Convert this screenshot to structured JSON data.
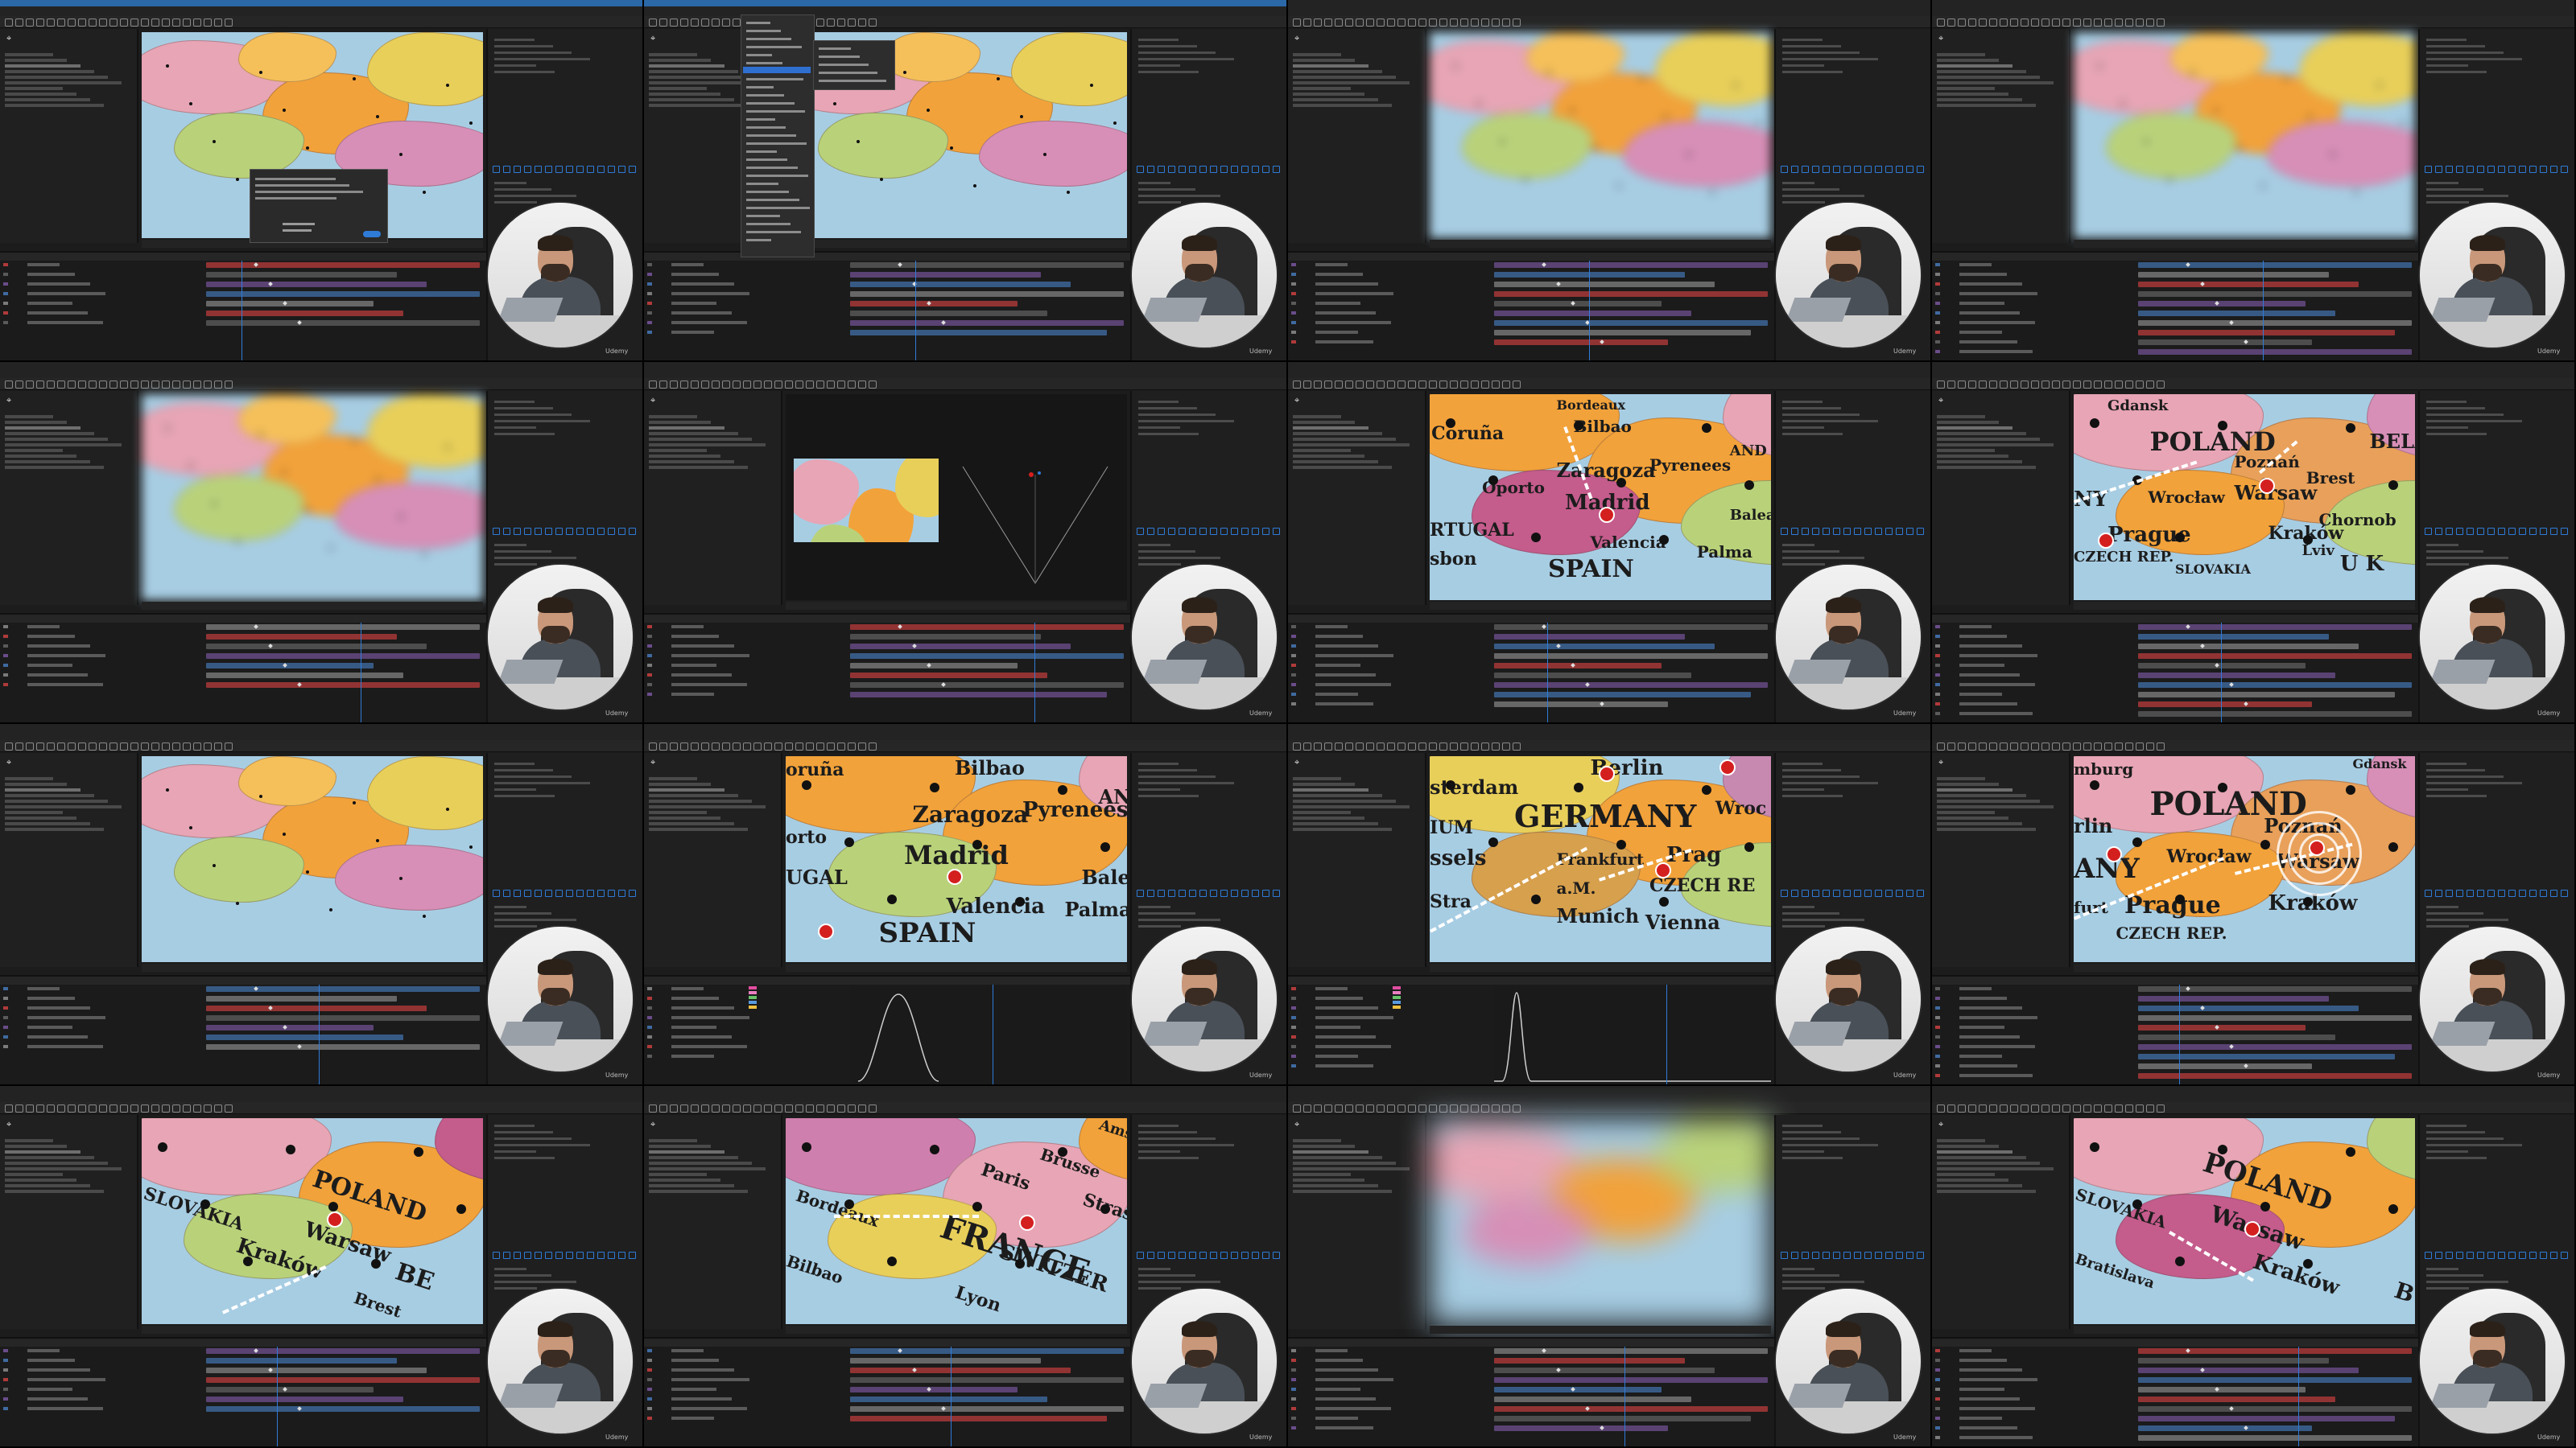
{
  "grid": {
    "rows": 4,
    "cols": 4
  },
  "watermark": "Udemy",
  "colors": {
    "ae_blue": "#2f7bd8",
    "timeline_red": "#b03a3a",
    "timeline_gray": "#5a5a5a",
    "poland_pink": "#e7a5b5",
    "spain_orange": "#f2a23a",
    "germany_yellow": "#e8cf5a",
    "sea_blue": "#a7cde3",
    "city_red": "#d41f1f"
  },
  "tiles": [
    {
      "id": "t01",
      "scene": "europe",
      "overlay": "dialog",
      "labels": []
    },
    {
      "id": "t02",
      "scene": "europe",
      "overlay": "menu",
      "labels": []
    },
    {
      "id": "t03",
      "scene": "europe-blur",
      "overlay": "none",
      "labels": []
    },
    {
      "id": "t04",
      "scene": "europe-blur",
      "overlay": "none",
      "labels": []
    },
    {
      "id": "t05",
      "scene": "europe-blur",
      "overlay": "none",
      "labels": []
    },
    {
      "id": "t06",
      "scene": "europe-small-3d",
      "overlay": "none",
      "labels": []
    },
    {
      "id": "t07",
      "scene": "spain",
      "overlay": "none",
      "labels": [
        "Bordeaux",
        "Coruña",
        "Bilbao",
        "Zaragoza",
        "Pyrenees",
        "Oporto",
        "Madrid",
        "RTUGAL",
        "Valencia",
        "Balear",
        "sbon",
        "SPAIN",
        "Palma",
        "AND"
      ]
    },
    {
      "id": "t08",
      "scene": "poland",
      "overlay": "none",
      "labels": [
        "Gdansk",
        "POLAND",
        "BELAR",
        "Poznań",
        "Brest",
        "NY",
        "Wrocław",
        "Warsaw",
        "Prague",
        "Kraków",
        "Chornob",
        "CZECH REP.",
        "SLOVAKIA",
        "Lviv",
        "U K"
      ]
    },
    {
      "id": "t09",
      "scene": "europe",
      "overlay": "none",
      "labels": []
    },
    {
      "id": "t10",
      "scene": "spain-close",
      "overlay": "graph",
      "labels": [
        "oruña",
        "Bilbao",
        "Zaragoza",
        "Pyrenees",
        "orto",
        "Madrid",
        "UGAL",
        "Valencia",
        "SPAIN",
        "Bale",
        "Palma",
        "AN"
      ]
    },
    {
      "id": "t11",
      "scene": "germany",
      "overlay": "graph",
      "labels": [
        "Berlin",
        "sterdam",
        "GERMANY",
        "Wroc",
        "ssels",
        "IUM",
        "Frankfurt",
        "a.M.",
        "Prag",
        "Stra",
        "Munich",
        "CZECH RE",
        "Vienna"
      ]
    },
    {
      "id": "t12",
      "scene": "poland-close",
      "overlay": "none",
      "labels": [
        "mburg",
        "Gdansk",
        "POLAND",
        "rlin",
        "Poznań",
        "ANY",
        "Wrocław",
        "Warsaw",
        "Prague",
        "Kraków",
        "furt",
        "CZECH REP."
      ]
    },
    {
      "id": "t13",
      "scene": "poland-tilt",
      "overlay": "none",
      "labels": [
        "POLAND",
        "SLOVAKIA",
        "Kraków",
        "Warsaw",
        "BE",
        "Brest"
      ]
    },
    {
      "id": "t14",
      "scene": "france",
      "overlay": "none",
      "labels": [
        "Bordeaux",
        "Paris",
        "Brusse",
        "Ams",
        "FRANCE",
        "SWITZER",
        "Lyon",
        "Strasb",
        "Bilbao"
      ]
    },
    {
      "id": "t15",
      "scene": "blur-full",
      "overlay": "none",
      "labels": []
    },
    {
      "id": "t16",
      "scene": "poland-tilt2",
      "overlay": "none",
      "labels": [
        "POLAND",
        "Warsaw",
        "Kraków",
        "SLOVAKIA",
        "Bratislava",
        "B"
      ]
    }
  ]
}
